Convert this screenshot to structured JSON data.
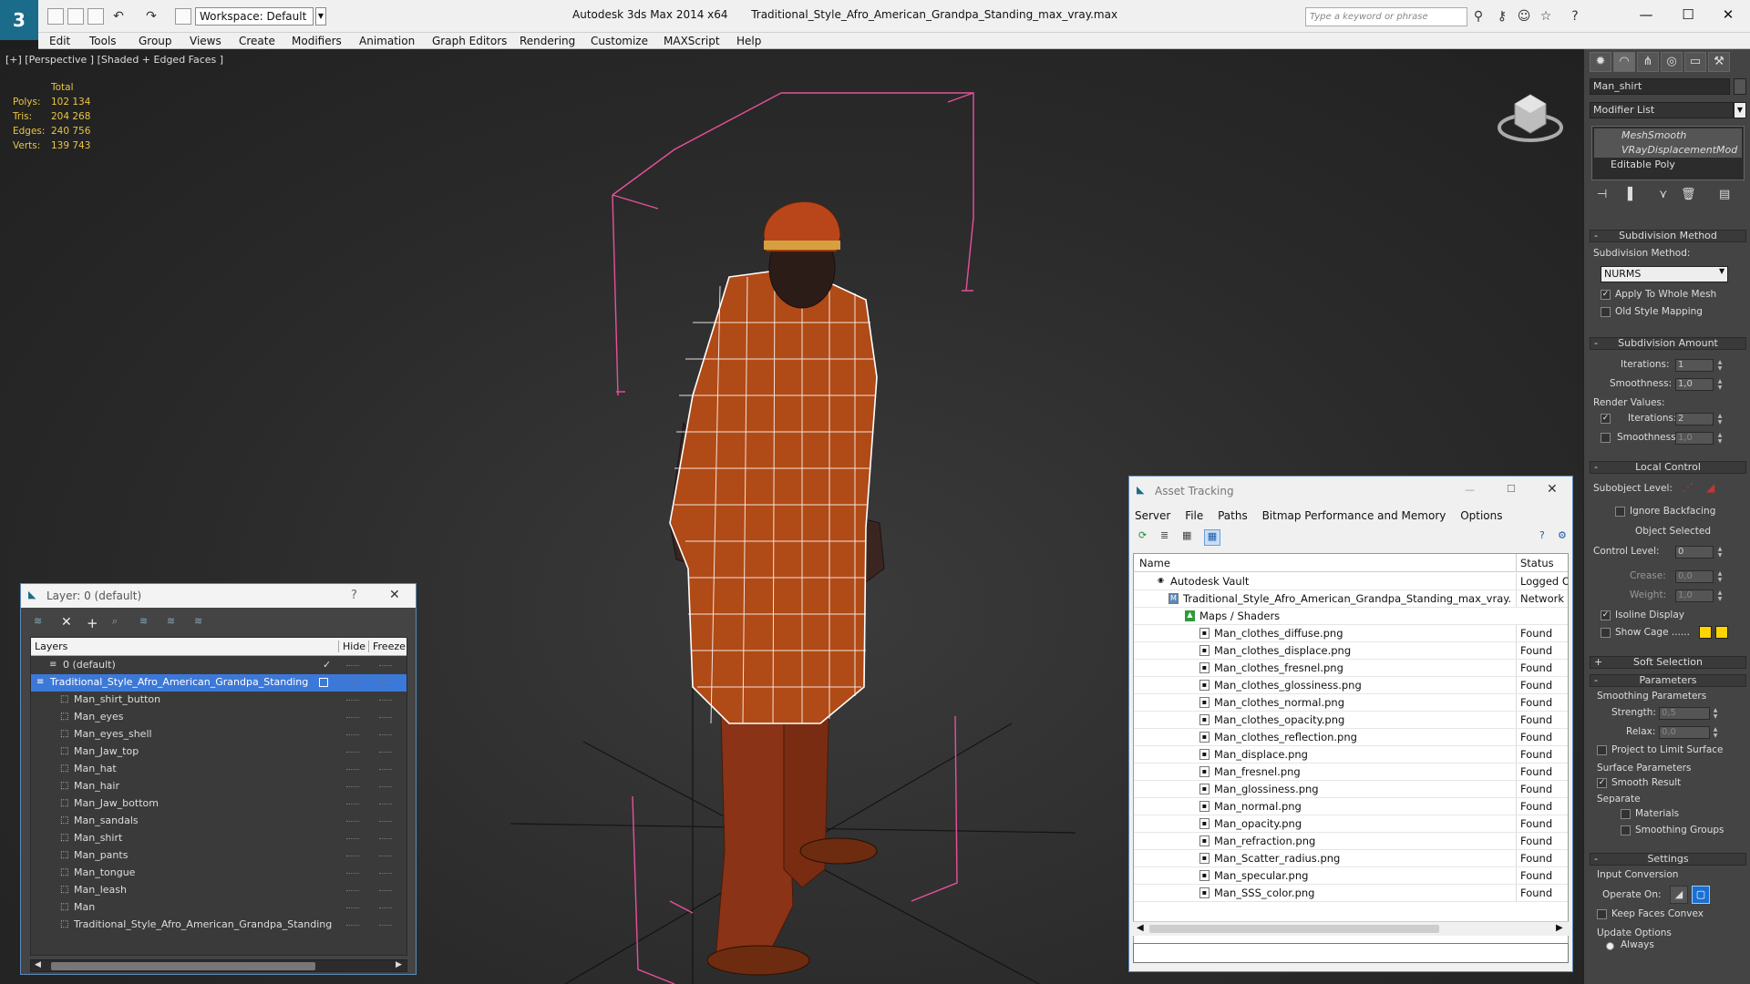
{
  "app": {
    "title": "Autodesk 3ds Max  2014 x64",
    "filename": "Traditional_Style_Afro_American_Grandpa_Standing_max_vray.max",
    "workspace": "Workspace: Default",
    "search_placeholder": "Type a keyword or phrase"
  },
  "menu": [
    "Edit",
    "Tools",
    "Group",
    "Views",
    "Create",
    "Modifiers",
    "Animation",
    "Graph Editors",
    "Rendering",
    "Customize",
    "MAXScript",
    "Help"
  ],
  "viewport": {
    "label": "[+] [Perspective ] [Shaded + Edged Faces ]",
    "stats_header": "Total",
    "stats": [
      {
        "label": "Polys:",
        "value": "102 134"
      },
      {
        "label": "Tris:",
        "value": "204 268"
      },
      {
        "label": "Edges:",
        "value": "240 756"
      },
      {
        "label": "Verts:",
        "value": "139 743"
      }
    ]
  },
  "command_panel": {
    "object_name": "Man_shirt",
    "modifier_list": "Modifier List",
    "stack": [
      "MeshSmooth",
      "VRayDisplacementMod",
      "Editable Poly"
    ],
    "subdivision_method": {
      "title": "Subdivision Method",
      "label": "Subdivision Method:",
      "value": "NURMS",
      "apply_whole_mesh": "Apply To Whole Mesh",
      "old_style": "Old Style Mapping"
    },
    "subdivision_amount": {
      "title": "Subdivision Amount",
      "iterations_label": "Iterations:",
      "iterations": "1",
      "smoothness_label": "Smoothness:",
      "smoothness": "1,0",
      "render_values": "Render Values:",
      "r_iterations_label": "Iterations:",
      "r_iterations": "2",
      "r_smoothness_label": "Smoothness:",
      "r_smoothness": "1,0"
    },
    "local_control": {
      "title": "Local Control",
      "subobject_label": "Subobject Level:",
      "ignore_backfacing": "Ignore Backfacing",
      "object_selected": "Object Selected",
      "control_level_label": "Control Level:",
      "control_level": "0",
      "crease_label": "Crease:",
      "crease": "0,0",
      "weight_label": "Weight:",
      "weight": "1,0",
      "isoline": "Isoline Display",
      "show_cage": "Show Cage ......"
    },
    "soft_selection": "Soft Selection",
    "parameters": {
      "title": "Parameters",
      "smoothing_params": "Smoothing Parameters",
      "strength_label": "Strength:",
      "strength": "0,5",
      "relax_label": "Relax:",
      "relax": "0,0",
      "project_limit": "Project to Limit Surface",
      "surface_params": "Surface Parameters",
      "smooth_result": "Smooth Result",
      "separate": "Separate",
      "materials": "Materials",
      "smoothing_groups": "Smoothing Groups"
    },
    "settings": {
      "title": "Settings",
      "input_conversion": "Input Conversion",
      "operate_on": "Operate On:",
      "keep_faces_convex": "Keep Faces Convex",
      "update_options": "Update Options",
      "always": "Always"
    }
  },
  "layer_dialog": {
    "title": "Layer: 0 (default)",
    "help": "?",
    "close": "✕",
    "col_layers": "Layers",
    "col_hide": "Hide",
    "col_freeze": "Freeze",
    "rows": [
      {
        "name": "0 (default)",
        "level": 1,
        "type": "layer"
      },
      {
        "name": "Traditional_Style_Afro_American_Grandpa_Standing",
        "level": 0,
        "type": "layer",
        "selected": true
      },
      {
        "name": "Man_shirt_button",
        "level": 2,
        "type": "object"
      },
      {
        "name": "Man_eyes",
        "level": 2,
        "type": "object"
      },
      {
        "name": "Man_eyes_shell",
        "level": 2,
        "type": "object"
      },
      {
        "name": "Man_Jaw_top",
        "level": 2,
        "type": "object"
      },
      {
        "name": "Man_hat",
        "level": 2,
        "type": "object"
      },
      {
        "name": "Man_hair",
        "level": 2,
        "type": "object"
      },
      {
        "name": "Man_Jaw_bottom",
        "level": 2,
        "type": "object"
      },
      {
        "name": "Man_sandals",
        "level": 2,
        "type": "object"
      },
      {
        "name": "Man_shirt",
        "level": 2,
        "type": "object"
      },
      {
        "name": "Man_pants",
        "level": 2,
        "type": "object"
      },
      {
        "name": "Man_tongue",
        "level": 2,
        "type": "object"
      },
      {
        "name": "Man_leash",
        "level": 2,
        "type": "object"
      },
      {
        "name": "Man",
        "level": 2,
        "type": "object"
      },
      {
        "name": "Traditional_Style_Afro_American_Grandpa_Standing",
        "level": 2,
        "type": "object"
      }
    ]
  },
  "asset_dialog": {
    "title": "Asset Tracking",
    "menu": [
      "Server",
      "File",
      "Paths",
      "Bitmap Performance and Memory",
      "Options"
    ],
    "col_name": "Name",
    "col_status": "Status",
    "rows": [
      {
        "name": "Autodesk Vault",
        "status": "Logged Out",
        "level": 0
      },
      {
        "name": "Traditional_Style_Afro_American_Grandpa_Standing_max_vray.max",
        "status": "Network Pa",
        "level": 1
      },
      {
        "name": "Maps / Shaders",
        "status": "",
        "level": 2
      },
      {
        "name": "Man_clothes_diffuse.png",
        "status": "Found",
        "level": 3
      },
      {
        "name": "Man_clothes_displace.png",
        "status": "Found",
        "level": 3
      },
      {
        "name": "Man_clothes_fresnel.png",
        "status": "Found",
        "level": 3
      },
      {
        "name": "Man_clothes_glossiness.png",
        "status": "Found",
        "level": 3
      },
      {
        "name": "Man_clothes_normal.png",
        "status": "Found",
        "level": 3
      },
      {
        "name": "Man_clothes_opacity.png",
        "status": "Found",
        "level": 3
      },
      {
        "name": "Man_clothes_reflection.png",
        "status": "Found",
        "level": 3
      },
      {
        "name": "Man_displace.png",
        "status": "Found",
        "level": 3
      },
      {
        "name": "Man_fresnel.png",
        "status": "Found",
        "level": 3
      },
      {
        "name": "Man_glossiness.png",
        "status": "Found",
        "level": 3
      },
      {
        "name": "Man_normal.png",
        "status": "Found",
        "level": 3
      },
      {
        "name": "Man_opacity.png",
        "status": "Found",
        "level": 3
      },
      {
        "name": "Man_refraction.png",
        "status": "Found",
        "level": 3
      },
      {
        "name": "Man_Scatter_radius.png",
        "status": "Found",
        "level": 3
      },
      {
        "name": "Man_specular.png",
        "status": "Found",
        "level": 3
      },
      {
        "name": "Man_SSS_color.png",
        "status": "Found",
        "level": 3
      }
    ]
  },
  "colors": {
    "accent_select": "#3c78d8",
    "stats_yellow": "#e8c545",
    "bbox_pink": "#e8509c",
    "cage_yellow": "#ffd400"
  }
}
